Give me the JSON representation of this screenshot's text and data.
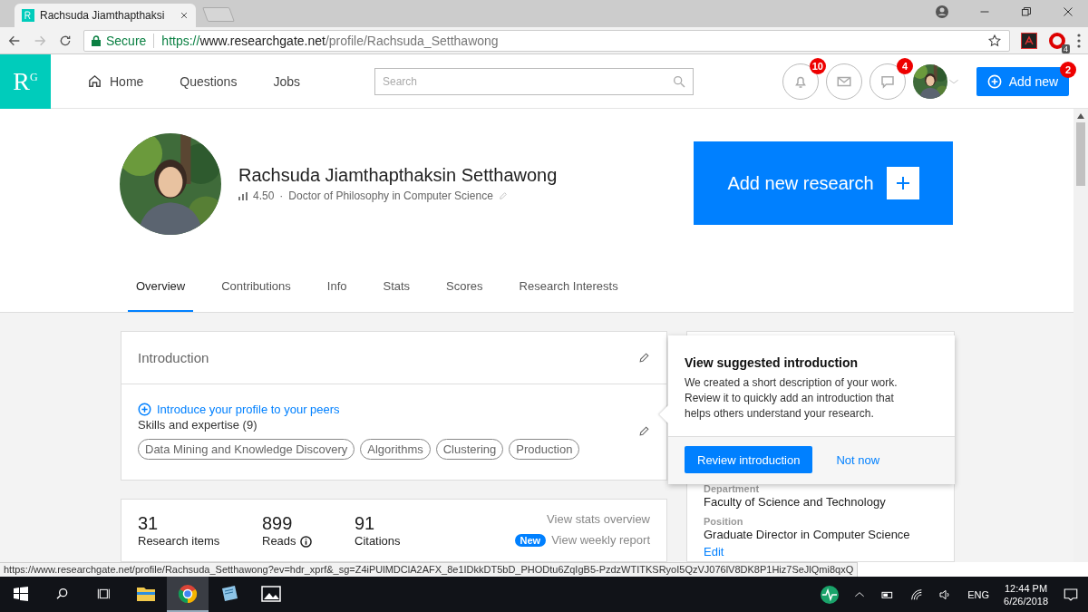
{
  "browser": {
    "tab_title": "Rachsuda Jiamthapthaksi",
    "secure_label": "Secure",
    "url": {
      "scheme": "https://",
      "host": "www.researchgate.net",
      "path": "/profile/Rachsuda_Setthawong"
    },
    "extension_badge": "4"
  },
  "header": {
    "logo": "R$^{G}$",
    "nav": [
      {
        "kind": "home",
        "label": "Home"
      },
      {
        "kind": "plain",
        "label": "Questions"
      },
      {
        "kind": "plain",
        "label": "Jobs"
      }
    ],
    "search": {
      "placeholder": "Search"
    },
    "notifications": [
      {
        "kind": "bell",
        "badge": "10"
      },
      {
        "kind": "mail"
      },
      {
        "kind": "chat",
        "badge": "4"
      }
    ],
    "add_new": {
      "label": "Add new",
      "badge": "2"
    }
  },
  "profile": {
    "name": "Rachsuda Jiamthapthaksin Setthawong",
    "score": "4.50",
    "separator": "·",
    "degree": "Doctor of Philosophy in Computer Science",
    "add_research": "Add new research",
    "tabs": [
      {
        "label": "Overview",
        "selected": true
      },
      {
        "label": "Contributions",
        "selected": false
      },
      {
        "label": "Info",
        "selected": false
      },
      {
        "label": "Stats",
        "selected": false
      },
      {
        "label": "Scores",
        "selected": false
      },
      {
        "label": "Research Interests",
        "selected": false
      }
    ]
  },
  "introduction": {
    "title": "Introduction",
    "link": "Introduce your profile to your peers",
    "skills_title": "Skills and expertise (9)",
    "skills": [
      "Data Mining and Knowledge Discovery",
      "Algorithms",
      "Clustering",
      "Production"
    ]
  },
  "stats": {
    "items": [
      {
        "value": "31",
        "label": "Research items",
        "info": false
      },
      {
        "value": "899",
        "label": "Reads",
        "info": true
      },
      {
        "value": "91",
        "label": "Citations",
        "info": false
      }
    ],
    "overview_link": "View stats overview",
    "new_badge": "New",
    "weekly_link": "View weekly report"
  },
  "popover": {
    "title": "View suggested introduction",
    "body": "We created a short description of your work. Review it to quickly add an introduction that helps others understand your research.",
    "primary": "Review introduction",
    "secondary": "Not now"
  },
  "details": {
    "fields": [
      {
        "label": "Department",
        "value": "Faculty of Science and Technology"
      },
      {
        "label": "Position",
        "value": "Graduate Director in Computer Science"
      }
    ],
    "edit": "Edit"
  },
  "status_url": "https://www.researchgate.net/profile/Rachsuda_Setthawong?ev=hdr_xprf&_sg=Z4iPUlMDClA2AFX_8e1IDkkDT5bD_PHODtu6ZqIgB5-PzdzWTITKSRyoI5QzVJ076lV8DK8P1Hiz7SeJlQmi8qxQ",
  "taskbar": {
    "apps": [
      {
        "kind": "explorer",
        "selected": false
      },
      {
        "kind": "chrome",
        "selected": true
      },
      {
        "kind": "notes",
        "selected": false
      },
      {
        "kind": "photos",
        "selected": false
      }
    ],
    "language": "ENG",
    "time": "12:44 PM",
    "date": "6/26/2018"
  }
}
